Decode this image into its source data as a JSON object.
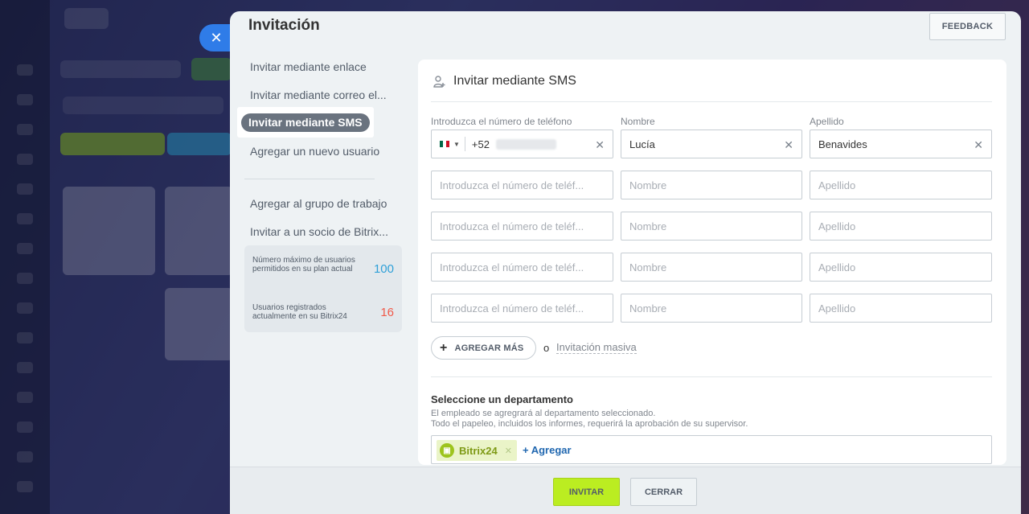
{
  "slider": {
    "title": "Invitación",
    "feedback_label": "FEEDBACK"
  },
  "menu": {
    "items": [
      {
        "label": "Invitar mediante enlace"
      },
      {
        "label": "Invitar mediante correo el..."
      },
      {
        "label": "Invitar mediante SMS"
      },
      {
        "label": "Agregar un nuevo usuario"
      },
      {
        "label": "Agregar al grupo de trabajo"
      },
      {
        "label": "Invitar a un socio de Bitrix..."
      }
    ],
    "stats": [
      {
        "label": "Número máximo de usuarios permitidos en su plan actual",
        "value": "100",
        "color": "#2fa0d8"
      },
      {
        "label": "Usuarios registrados actualmente en su Bitrix24",
        "value": "16",
        "color": "#f05a4a"
      }
    ]
  },
  "card": {
    "title": "Invitar mediante SMS",
    "columns": {
      "phone": "Introduzca el número de teléfono",
      "name": "Nombre",
      "surname": "Apellido"
    },
    "first_row": {
      "phone_prefix": "+52",
      "name": "Lucía",
      "surname": "Benavides"
    },
    "placeholders": {
      "phone": "Introduzca el número de teléf...",
      "name": "Nombre",
      "surname": "Apellido"
    },
    "add_more_label": "AGREGAR MÁS",
    "or_label": "o",
    "mass_invite_label": "Invitación masiva",
    "department": {
      "title": "Seleccione un departamento",
      "desc1": "El empleado se agregrará al departamento seleccionado.",
      "desc2": "Todo el papeleo, incluidos los informes, requerirá la aprobación de su supervisor.",
      "tag_label": "Bitrix24",
      "add_label": "+ Agregar"
    }
  },
  "footer": {
    "invite_label": "INVITAR",
    "close_label": "CERRAR"
  },
  "colors": {
    "accent_green": "#bbed21",
    "link_blue": "#2067b0",
    "close_blue": "#2f7ce8"
  }
}
